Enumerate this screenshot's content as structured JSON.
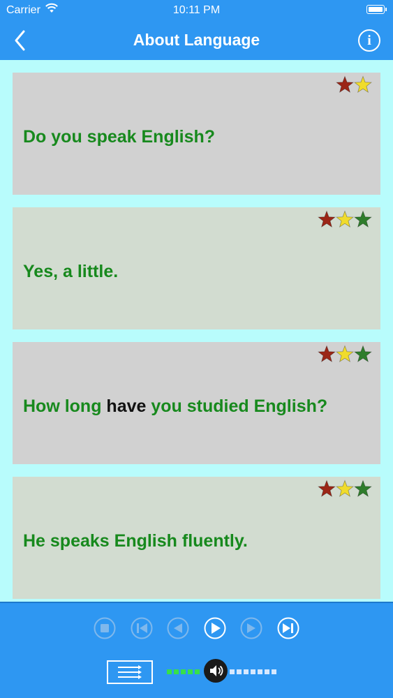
{
  "status_bar": {
    "carrier": "Carrier",
    "time": "10:11 PM",
    "wifi_icon": "wifi-icon",
    "battery_icon": "battery-icon"
  },
  "nav": {
    "title": "About Language",
    "back_icon": "chevron-left-icon",
    "info_icon": "info-icon",
    "info_glyph": "i"
  },
  "colors": {
    "bar": "#2e97f2",
    "background": "#b8fcfc",
    "phrase_green": "#17891d",
    "highlight": "#111111",
    "card_gray": "#d1d1d1",
    "card_green": "#d2dcd0",
    "star_red": "#9b2617",
    "star_yellow": "#f0dc2c",
    "star_green": "#2f7d2c"
  },
  "phrases": [
    {
      "parts": [
        {
          "text": "Do you speak English?",
          "hl": false
        }
      ],
      "stars": [
        "red",
        "yellow"
      ],
      "bg": "gray"
    },
    {
      "parts": [
        {
          "text": "Yes, a little.",
          "hl": false
        }
      ],
      "stars": [
        "red",
        "yellow",
        "green"
      ],
      "bg": "green"
    },
    {
      "parts": [
        {
          "text": "How long ",
          "hl": false
        },
        {
          "text": "have",
          "hl": true
        },
        {
          "text": " you studied English?",
          "hl": false
        }
      ],
      "stars": [
        "red",
        "yellow",
        "green"
      ],
      "bg": "gray"
    },
    {
      "parts": [
        {
          "text": "He speaks English fluently.",
          "hl": false
        }
      ],
      "stars": [
        "red",
        "yellow",
        "green"
      ],
      "bg": "green"
    }
  ],
  "player": {
    "controls": [
      {
        "name": "stop-button",
        "icon": "stop-icon",
        "enabled": false
      },
      {
        "name": "skip-back-button",
        "icon": "skip-back-icon",
        "enabled": false
      },
      {
        "name": "previous-button",
        "icon": "previous-icon",
        "enabled": false
      },
      {
        "name": "play-button",
        "icon": "play-icon",
        "enabled": true
      },
      {
        "name": "next-button",
        "icon": "next-icon",
        "enabled": false
      },
      {
        "name": "skip-forward-button",
        "icon": "skip-forward-icon",
        "enabled": true
      }
    ],
    "list_icon": "list-icon",
    "volume": {
      "icon": "speaker-icon",
      "level": 0.4,
      "segments": 16
    }
  }
}
